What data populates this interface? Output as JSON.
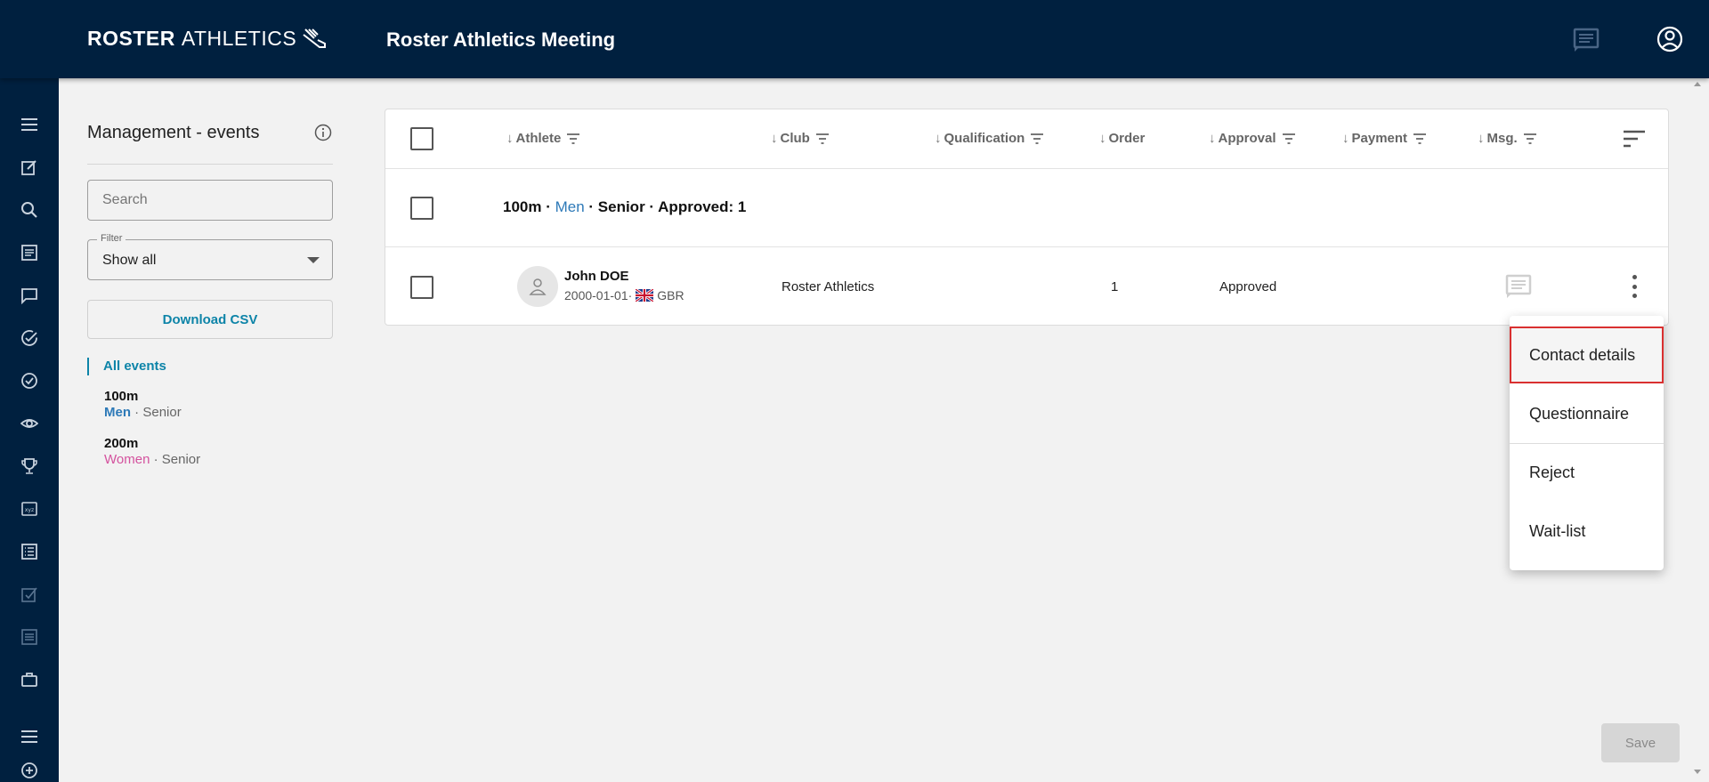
{
  "header": {
    "logo_bold": "ROSTER",
    "logo_thin": "ATHLETICS",
    "app_title": "Roster Athletics Meeting"
  },
  "rail": {
    "icons": [
      "menu-icon",
      "edit-icon",
      "search-icon",
      "list-icon",
      "chat-icon",
      "check-circle-icon",
      "check-circle-icon",
      "eye-icon",
      "trophy-icon",
      "xyz-icon",
      "list-alt-icon",
      "checkbox-icon",
      "list-icon",
      "briefcase-icon",
      "menu-icon",
      "add-circle-icon"
    ]
  },
  "panel": {
    "title": "Management - events",
    "search_placeholder": "Search",
    "filter_label": "Filter",
    "filter_value": "Show all",
    "download_label": "Download CSV",
    "all_events": "All events",
    "events": [
      {
        "name": "100m",
        "gender": "Men",
        "sep": " · ",
        "category": "Senior"
      },
      {
        "name": "200m",
        "gender": "Women",
        "sep": " · ",
        "category": "Senior"
      }
    ]
  },
  "table": {
    "columns": [
      {
        "arrow": "↓",
        "label": "Athlete"
      },
      {
        "arrow": "↓",
        "label": "Club"
      },
      {
        "arrow": "↓",
        "label": "Qualification"
      },
      {
        "arrow": "↓",
        "label": "Order"
      },
      {
        "arrow": "↓",
        "label": "Approval"
      },
      {
        "arrow": "↓",
        "label": "Payment"
      },
      {
        "arrow": "↓",
        "label": "Msg."
      }
    ],
    "group": {
      "event": "100m",
      "sep1": " · ",
      "gender": "Men",
      "rest": " · Senior · Approved: 1"
    },
    "rows": [
      {
        "name": "John DOE",
        "dob": "2000-01-01",
        "sep": " · ",
        "country": "GBR",
        "club": "Roster Athletics",
        "order": "1",
        "approval": "Approved"
      }
    ]
  },
  "menu": {
    "items": [
      "Contact details",
      "Questionnaire",
      "Reject",
      "Wait-list"
    ]
  },
  "footer": {
    "save_label": "Save"
  },
  "colors": {
    "navy": "#00203f",
    "accent": "#0d84a8",
    "men": "#2e7ab8",
    "women": "#d4529e",
    "highlight": "#d93030"
  }
}
